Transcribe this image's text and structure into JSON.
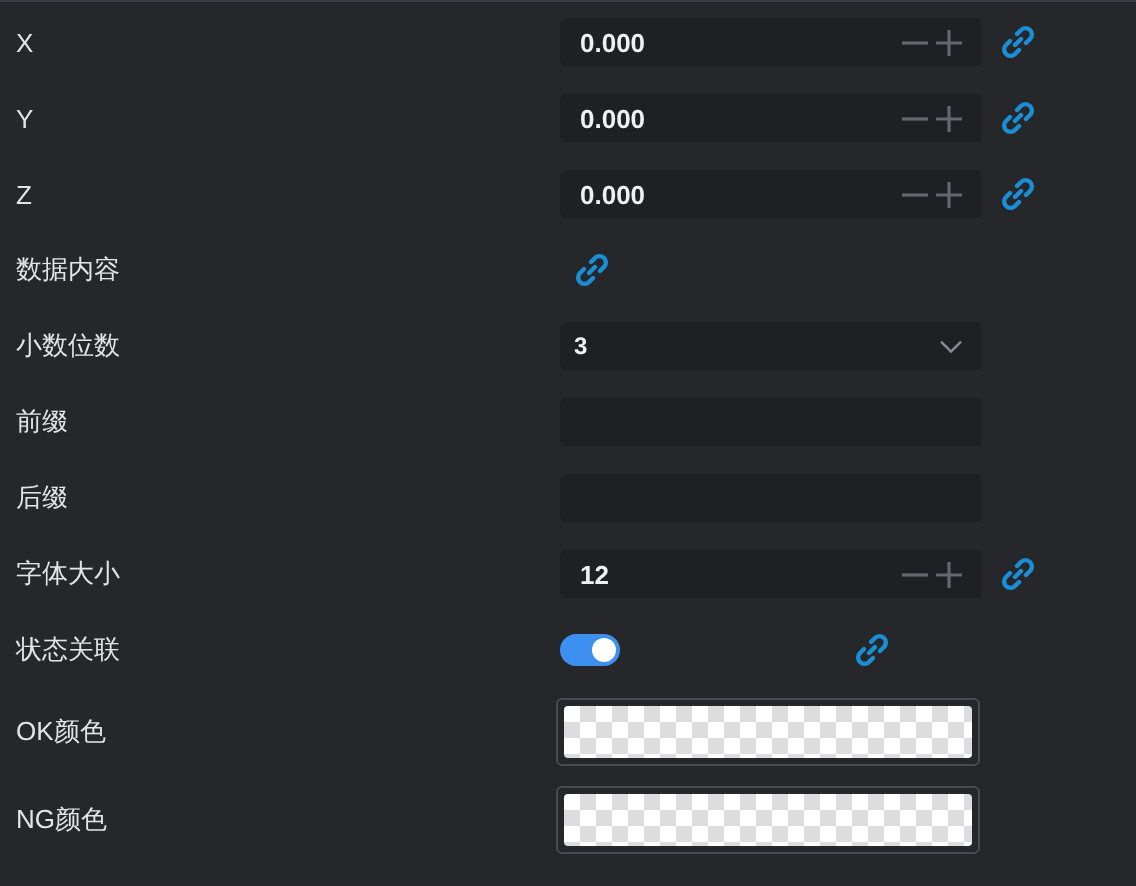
{
  "rows": [
    {
      "kind": "number",
      "label": "X",
      "value": "0.000",
      "linked": true
    },
    {
      "kind": "number",
      "label": "Y",
      "value": "0.000",
      "linked": true
    },
    {
      "kind": "number",
      "label": "Z",
      "value": "0.000",
      "linked": true
    },
    {
      "kind": "link",
      "label": "数据内容",
      "linked": true
    },
    {
      "kind": "select",
      "label": "小数位数",
      "value": "3"
    },
    {
      "kind": "text",
      "label": "前缀"
    },
    {
      "kind": "text",
      "label": "后缀"
    },
    {
      "kind": "number",
      "label": "字体大小",
      "value": "12",
      "linked": true
    },
    {
      "kind": "toggle",
      "label": "状态关联",
      "on": true,
      "linked": true
    },
    {
      "kind": "color",
      "label": "OK颜色"
    },
    {
      "kind": "color",
      "label": "NG颜色"
    }
  ]
}
